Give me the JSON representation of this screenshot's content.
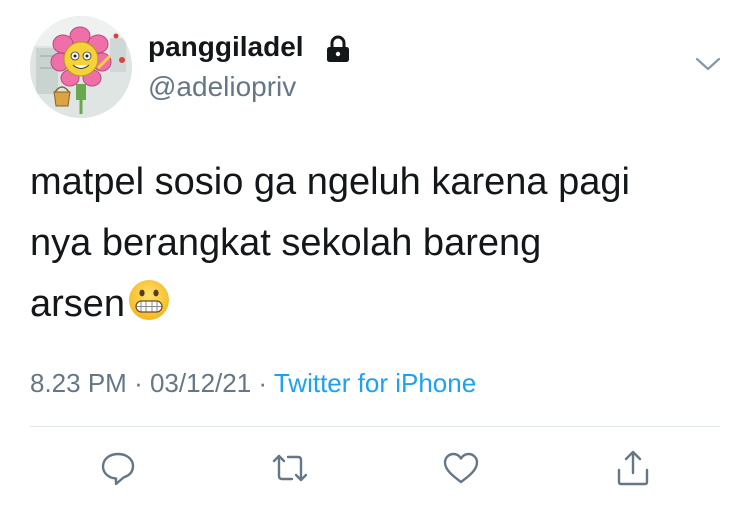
{
  "tweet": {
    "author": {
      "display_name": "panggiladel",
      "handle": "@adeliopriv",
      "protected_icon": "lock-icon",
      "avatar": "flower-character-avatar"
    },
    "text_lines": [
      "matpel sosio ga ngeluh karena pagi",
      "nya berangkat sekolah bareng",
      "arsen"
    ],
    "text_emoji": "grimacing-face-emoji",
    "time": "8.23 PM",
    "date": "03/12/21",
    "separator": "·",
    "source": "Twitter for iPhone",
    "menu_icon": "chevron-down-icon"
  },
  "actions": [
    {
      "icon": "reply-icon"
    },
    {
      "icon": "retweet-icon"
    },
    {
      "icon": "like-icon"
    },
    {
      "icon": "share-icon"
    }
  ],
  "colors": {
    "text": "#14171a",
    "secondary": "#657786",
    "link": "#1da1f2",
    "divider": "#e1e8ed"
  }
}
